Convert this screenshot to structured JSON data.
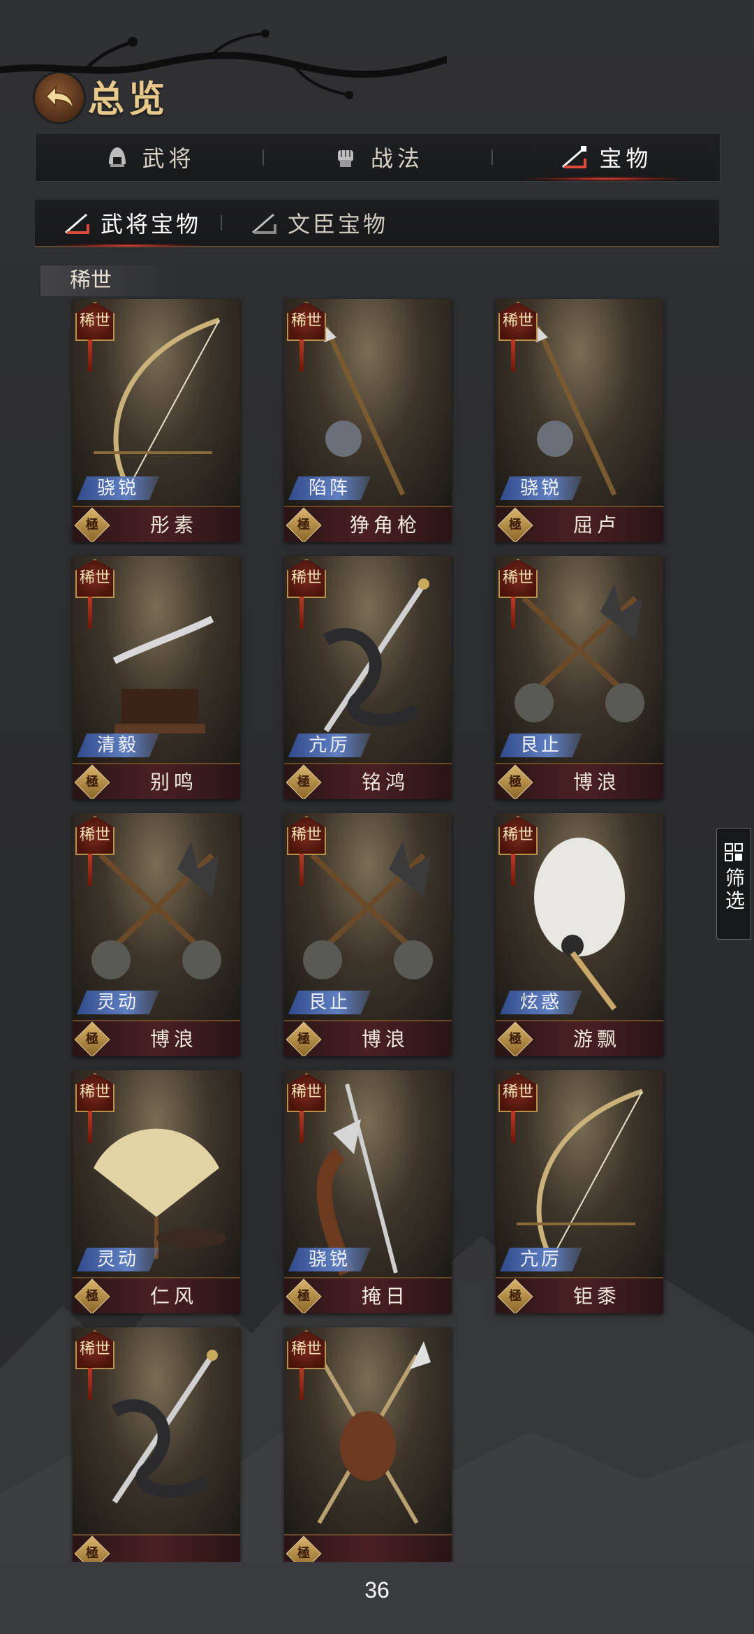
{
  "header": {
    "title": "总览"
  },
  "tabs": [
    {
      "label": "武将",
      "icon": "helmet-icon",
      "active": false
    },
    {
      "label": "战法",
      "icon": "fist-icon",
      "active": false
    },
    {
      "label": "宝物",
      "icon": "weapon-icon",
      "active": true
    }
  ],
  "subtabs": [
    {
      "label": "武将宝物",
      "icon": "weapon-icon",
      "active": true
    },
    {
      "label": "文臣宝物",
      "icon": "weapon-icon",
      "active": false
    }
  ],
  "section": {
    "label": "稀世"
  },
  "rarity_badge": "稀世",
  "grade_badge": "極",
  "items": [
    {
      "trait": "骁锐",
      "name": "彤素",
      "art": "bow"
    },
    {
      "trait": "陷阵",
      "name": "狰角枪",
      "art": "spear"
    },
    {
      "trait": "骁锐",
      "name": "屈卢",
      "art": "spear"
    },
    {
      "trait": "清毅",
      "name": "别鸣",
      "art": "saber"
    },
    {
      "trait": "亢厉",
      "name": "铭鸿",
      "art": "sword"
    },
    {
      "trait": "艮止",
      "name": "博浪",
      "art": "hammer"
    },
    {
      "trait": "灵动",
      "name": "博浪",
      "art": "hammer"
    },
    {
      "trait": "艮止",
      "name": "博浪",
      "art": "hammer"
    },
    {
      "trait": "炫惑",
      "name": "游飘",
      "art": "fan"
    },
    {
      "trait": "灵动",
      "name": "仁风",
      "art": "folding-fan"
    },
    {
      "trait": "骁锐",
      "name": "掩日",
      "art": "halberd"
    },
    {
      "trait": "亢厉",
      "name": "钜黍",
      "art": "bow"
    },
    {
      "trait": "",
      "name": "",
      "art": "sword"
    },
    {
      "trait": "",
      "name": "",
      "art": "crossed-spears"
    }
  ],
  "filter_button": {
    "label": "筛选",
    "icon": "grid-icon"
  },
  "page_number": "36"
}
